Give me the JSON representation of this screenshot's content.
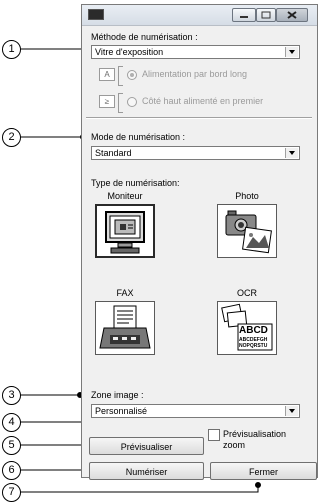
{
  "callouts": [
    "1",
    "2",
    "3",
    "4",
    "5",
    "6",
    "7"
  ],
  "window": {
    "icon_name": "app-icon"
  },
  "scan_method": {
    "label": "Méthode de numérisation :",
    "value": "Vitre d'exposition",
    "feed_option_long": "Alimentation par bord long",
    "feed_option_top": "Côté haut alimenté en premier",
    "feed_long_icon": "A",
    "feed_top_icon": "≥"
  },
  "scan_mode": {
    "label": "Mode de numérisation :",
    "value": "Standard",
    "type_label": "Type de numérisation:",
    "tiles": [
      {
        "label": "Moniteur",
        "icon": "monitor-icon"
      },
      {
        "label": "Photo",
        "icon": "camera-photo-icon"
      },
      {
        "label": "FAX",
        "icon": "fax-icon"
      },
      {
        "label": "OCR",
        "icon": "ocr-document-icon",
        "sample_lines": [
          "ABCD",
          "ABCDEFGH",
          "NOPQRSTU"
        ]
      }
    ]
  },
  "image_area": {
    "label": "Zone image :",
    "value": "Personnalisé"
  },
  "buttons": {
    "preview": "Prévisualiser",
    "scan": "Numériser",
    "close": "Fermer"
  },
  "zoom_preview": {
    "label_line1": "Prévisualisation",
    "label_line2": "zoom",
    "checked": false
  }
}
